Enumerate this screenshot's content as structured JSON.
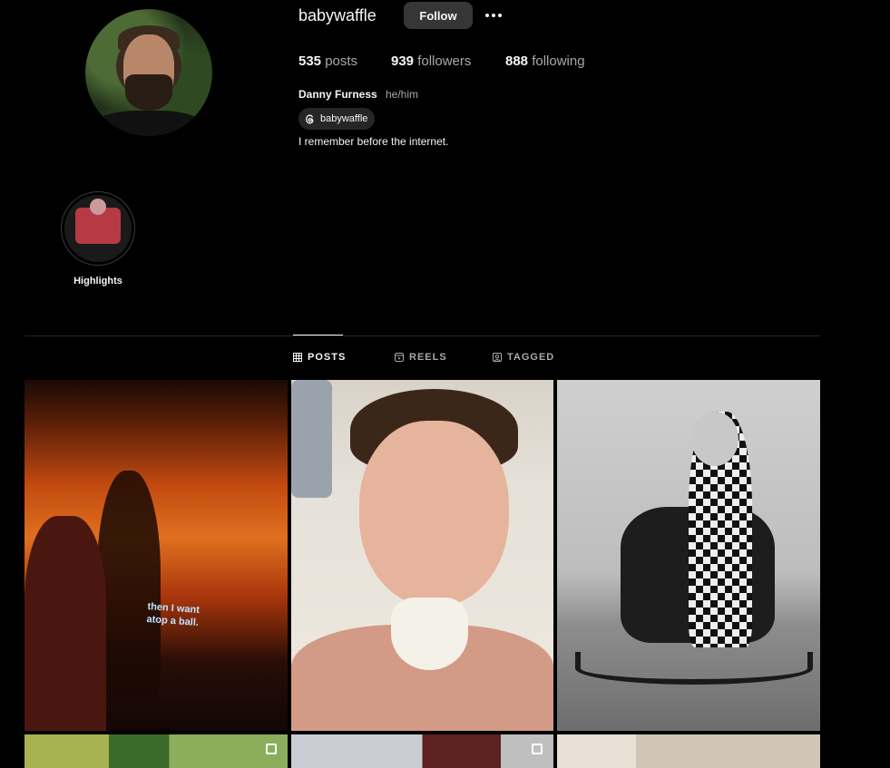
{
  "profile": {
    "username": "babywaffle",
    "follow_label": "Follow",
    "full_name": "Danny Furness",
    "pronouns": "he/him",
    "threads_handle": "babywaffle",
    "bio": "I remember before the internet."
  },
  "stats": {
    "posts_count": "535",
    "posts_label": "posts",
    "followers_count": "939",
    "followers_label": "followers",
    "following_count": "888",
    "following_label": "following"
  },
  "highlights": [
    {
      "label": "Highlights"
    }
  ],
  "tabs": [
    {
      "label": "POSTS",
      "icon": "grid-icon",
      "active": true
    },
    {
      "label": "REELS",
      "icon": "reels-icon",
      "active": false
    },
    {
      "label": "TAGGED",
      "icon": "tagged-icon",
      "active": false
    }
  ],
  "posts": [
    {
      "caption_overlay": "then I want\natop a ball."
    },
    {},
    {},
    {
      "carousel": true
    },
    {
      "carousel": true
    },
    {}
  ],
  "colors": {
    "background": "#000000",
    "button": "#363636",
    "muted_text": "#a8a8a8",
    "divider": "#262626"
  }
}
